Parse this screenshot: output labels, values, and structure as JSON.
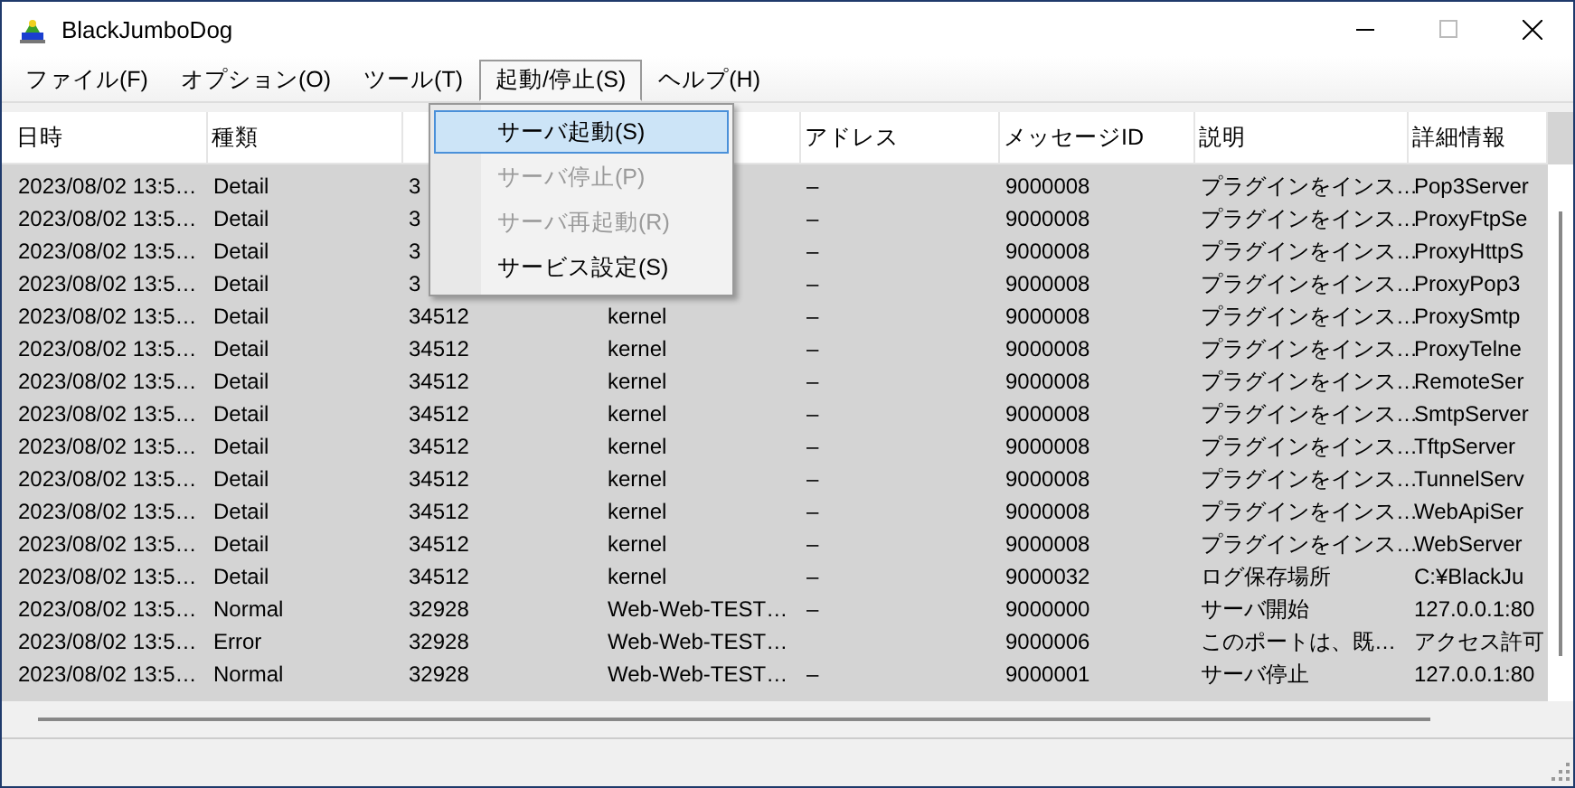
{
  "window": {
    "title": "BlackJumboDog"
  },
  "menu_bar": [
    {
      "label": "ファイル(F)",
      "selected": false
    },
    {
      "label": "オプション(O)",
      "selected": false
    },
    {
      "label": "ツール(T)",
      "selected": false
    },
    {
      "label": "起動/停止(S)",
      "selected": true
    },
    {
      "label": "ヘルプ(H)",
      "selected": false
    }
  ],
  "dropdown": [
    {
      "label": "サーバ起動(S)",
      "selected": true,
      "disabled": false
    },
    {
      "label": "サーバ停止(P)",
      "selected": false,
      "disabled": true
    },
    {
      "label": "サーバ再起動(R)",
      "selected": false,
      "disabled": true
    },
    {
      "label": "サービス設定(S)",
      "selected": false,
      "disabled": false
    }
  ],
  "table": {
    "columns": [
      "日時",
      "種類",
      null,
      null,
      "アドレス",
      "メッセージID",
      "説明",
      "詳細情報"
    ],
    "rows": [
      [
        "2023/08/02 13:5…",
        "Detail",
        "3",
        null,
        "–",
        "9000008",
        "プラグインをインス…",
        "Pop3Server"
      ],
      [
        "2023/08/02 13:5…",
        "Detail",
        "3",
        null,
        "–",
        "9000008",
        "プラグインをインス…",
        "ProxyFtpSe"
      ],
      [
        "2023/08/02 13:5…",
        "Detail",
        "3",
        null,
        "–",
        "9000008",
        "プラグインをインス…",
        "ProxyHttpS"
      ],
      [
        "2023/08/02 13:5…",
        "Detail",
        "3",
        null,
        "–",
        "9000008",
        "プラグインをインス…",
        "ProxyPop3"
      ],
      [
        "2023/08/02 13:5…",
        "Detail",
        "34512",
        "kernel",
        "–",
        "9000008",
        "プラグインをインス…",
        "ProxySmtp"
      ],
      [
        "2023/08/02 13:5…",
        "Detail",
        "34512",
        "kernel",
        "–",
        "9000008",
        "プラグインをインス…",
        "ProxyTelne"
      ],
      [
        "2023/08/02 13:5…",
        "Detail",
        "34512",
        "kernel",
        "–",
        "9000008",
        "プラグインをインス…",
        "RemoteSer"
      ],
      [
        "2023/08/02 13:5…",
        "Detail",
        "34512",
        "kernel",
        "–",
        "9000008",
        "プラグインをインス…",
        "SmtpServer"
      ],
      [
        "2023/08/02 13:5…",
        "Detail",
        "34512",
        "kernel",
        "–",
        "9000008",
        "プラグインをインス…",
        "TftpServer"
      ],
      [
        "2023/08/02 13:5…",
        "Detail",
        "34512",
        "kernel",
        "–",
        "9000008",
        "プラグインをインス…",
        "TunnelServ"
      ],
      [
        "2023/08/02 13:5…",
        "Detail",
        "34512",
        "kernel",
        "–",
        "9000008",
        "プラグインをインス…",
        "WebApiSer"
      ],
      [
        "2023/08/02 13:5…",
        "Detail",
        "34512",
        "kernel",
        "–",
        "9000008",
        "プラグインをインス…",
        "WebServer"
      ],
      [
        "2023/08/02 13:5…",
        "Detail",
        "34512",
        "kernel",
        "–",
        "9000032",
        "ログ保存場所",
        "C:¥BlackJu"
      ],
      [
        "2023/08/02 13:5…",
        "Normal",
        "32928",
        "Web-Web-TEST…",
        "–",
        "9000000",
        "サーバ開始",
        "127.0.0.1:80"
      ],
      [
        "2023/08/02 13:5…",
        "Error",
        "32928",
        "Web-Web-TEST…",
        null,
        "9000006",
        "このポートは、既…",
        "アクセス許可"
      ],
      [
        "2023/08/02 13:5…",
        "Normal",
        "32928",
        "Web-Web-TEST…",
        "–",
        "9000001",
        "サーバ停止",
        "127.0.0.1:80"
      ]
    ]
  }
}
